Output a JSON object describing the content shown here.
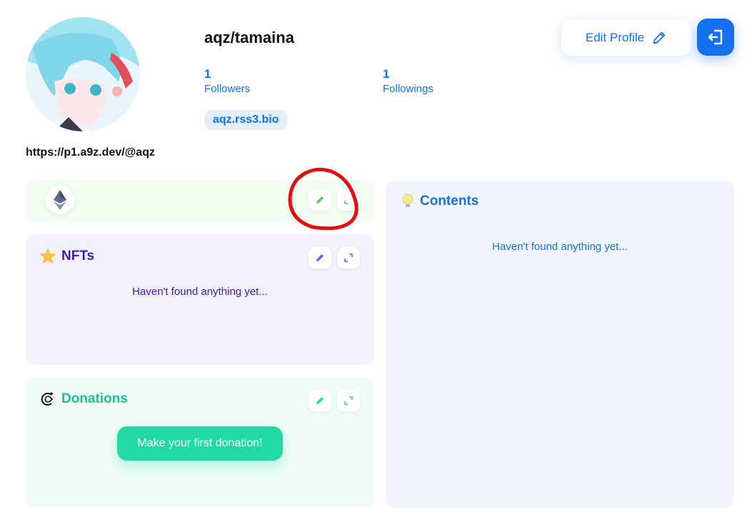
{
  "profile": {
    "username": "aqz/tamaina",
    "followers_count": "1",
    "followers_label": "Followers",
    "followings_count": "1",
    "followings_label": "Followings",
    "rss_link": "aqz.rss3.bio",
    "website": "https://p1.a9z.dev/@aqz"
  },
  "header": {
    "edit_profile_label": "Edit Profile"
  },
  "sections": {
    "nfts": {
      "title": "NFTs",
      "empty_text": "Haven't found anything yet..."
    },
    "donations": {
      "title": "Donations",
      "cta_label": "Make your first donation!"
    },
    "contents": {
      "title": "Contents",
      "empty_text": "Haven't found anything yet..."
    }
  },
  "colors": {
    "primary": "#1570ef",
    "nfts_accent": "#7c4dff",
    "donations_accent": "#20d9a4",
    "eth_accent": "#4cd34c",
    "annotation": "#e01010"
  },
  "icons": {
    "edit": "pencil-icon",
    "expand": "expand-icon",
    "logout": "logout-icon",
    "eth": "ethereum-icon",
    "nfts": "star-icon",
    "donations": "gitcoin-icon",
    "contents": "lightbulb-icon"
  }
}
